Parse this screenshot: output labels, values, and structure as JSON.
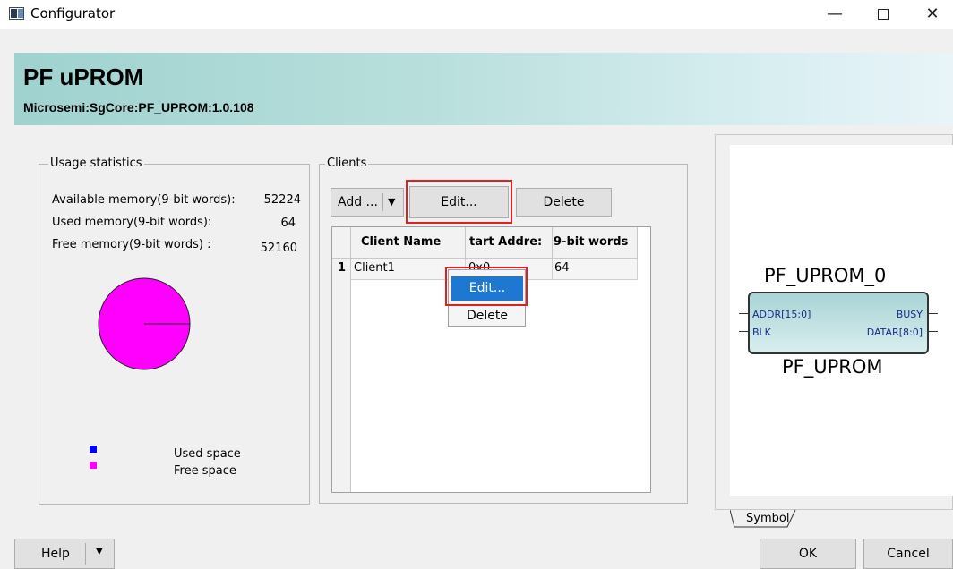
{
  "window": {
    "title": "Configurator",
    "minimize": "—",
    "close": "✕"
  },
  "banner": {
    "title": "PF uPROM",
    "subtitle": "Microsemi:SgCore:PF_UPROM:1.0.108"
  },
  "usage": {
    "legend": "Usage statistics",
    "available_label": "Available memory(9-bit words):",
    "available_value": "52224",
    "used_label": "Used memory(9-bit words):",
    "used_value": "64",
    "free_label": "Free memory(9-bit words) :",
    "free_value": "52160",
    "pie": {
      "used": 64,
      "free": 52160,
      "used_color": "#0000ff",
      "free_color": "#ff00ff"
    },
    "legend_used": "Used space",
    "legend_free": "Free space"
  },
  "clients": {
    "legend": "Clients",
    "add_label": "Add ...",
    "edit_label": "Edit...",
    "delete_label": "Delete",
    "columns": [
      "Client Name",
      "tart Addre:",
      "9-bit words"
    ],
    "rows": [
      {
        "index": "1",
        "name": "Client1",
        "start": "0x0",
        "words": "64"
      }
    ]
  },
  "context_menu": {
    "edit": "Edit...",
    "delete": "Delete"
  },
  "symbol": {
    "instance": "PF_UPROM_0",
    "type": "PF_UPROM",
    "ports_left": [
      "ADDR[15:0]",
      "BLK"
    ],
    "ports_right": [
      "BUSY",
      "DATAR[8:0]"
    ],
    "tab": "Symbol"
  },
  "footer": {
    "help": "Help",
    "ok": "OK",
    "cancel": "Cancel"
  }
}
